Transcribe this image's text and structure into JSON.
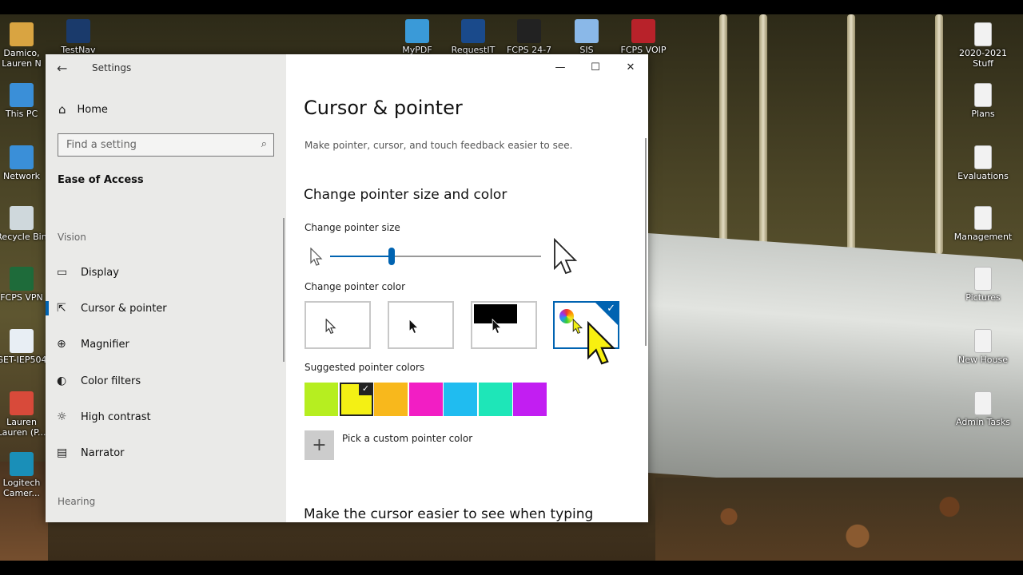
{
  "desktop": {
    "icons_left": [
      {
        "label": "Damico,\nLauren N",
        "icon": "user-folder-icon",
        "color": "#d9a441"
      },
      {
        "label": "This PC",
        "icon": "computer-icon",
        "color": "#3a8fd8"
      },
      {
        "label": "Network",
        "icon": "network-icon",
        "color": "#3a8fd8"
      },
      {
        "label": "Recycle Bin",
        "icon": "recycle-bin-icon",
        "color": "#cfd8dc"
      },
      {
        "label": "FCPS VPN",
        "icon": "vpn-icon",
        "color": "#1e6b3a"
      },
      {
        "label": "GET-IEP504",
        "icon": "app-icon",
        "color": "#e8eef4"
      },
      {
        "label": "Lauren\nLauren (P...",
        "icon": "chrome-icon",
        "color": "#d84a3a"
      },
      {
        "label": "Logitech\nCamer...",
        "icon": "camera-icon",
        "color": "#1a8fb8"
      }
    ],
    "icons_top": [
      {
        "label": "TestNav",
        "icon": "pearson-icon",
        "color": "#1a3a6b"
      },
      {
        "label": "MyPDF",
        "icon": "pdf-icon",
        "color": "#3a9ad8"
      },
      {
        "label": "RequestIT",
        "icon": "request-icon",
        "color": "#1a4a8b"
      },
      {
        "label": "FCPS 24-7",
        "icon": "blackboard-icon",
        "color": "#222222"
      },
      {
        "label": "SIS",
        "icon": "sis-icon",
        "color": "#8ab8e8"
      },
      {
        "label": "FCPS VOIP",
        "icon": "voip-icon",
        "color": "#b8222a"
      }
    ],
    "icons_right": [
      {
        "label": "2020-2021\nStuff",
        "icon": "document-icon"
      },
      {
        "label": "Plans",
        "icon": "document-icon"
      },
      {
        "label": "Evaluations",
        "icon": "document-icon"
      },
      {
        "label": "Management",
        "icon": "document-icon"
      },
      {
        "label": "Pictures",
        "icon": "document-icon"
      },
      {
        "label": "New House",
        "icon": "document-icon"
      },
      {
        "label": "Admin Tasks",
        "icon": "book-icon"
      }
    ]
  },
  "window": {
    "app_title": "Settings",
    "back_glyph": "←",
    "caption": {
      "minimize": "—",
      "maximize": "☐",
      "close": "✕"
    }
  },
  "nav": {
    "home": "Home",
    "search_placeholder": "Find a setting",
    "breadcrumb": "Ease of Access",
    "group_vision": "Vision",
    "group_hearing": "Hearing",
    "items": [
      {
        "label": "Display",
        "icon": "display-icon",
        "glyph": "▭",
        "active": false
      },
      {
        "label": "Cursor & pointer",
        "icon": "cursor-icon",
        "glyph": "⇱",
        "active": true
      },
      {
        "label": "Magnifier",
        "icon": "magnifier-icon",
        "glyph": "⊕",
        "active": false
      },
      {
        "label": "Color filters",
        "icon": "color-filters-icon",
        "glyph": "◐",
        "active": false
      },
      {
        "label": "High contrast",
        "icon": "high-contrast-icon",
        "glyph": "☼",
        "active": false
      },
      {
        "label": "Narrator",
        "icon": "narrator-icon",
        "glyph": "▤",
        "active": false
      }
    ]
  },
  "content": {
    "title": "Cursor & pointer",
    "description": "Make pointer, cursor, and touch feedback easier to see.",
    "section_size_color": "Change pointer size and color",
    "size_label": "Change pointer size",
    "size_value": 0.29,
    "color_label": "Change pointer color",
    "pointer_colors": [
      {
        "name": "white",
        "selected": false
      },
      {
        "name": "black",
        "selected": false
      },
      {
        "name": "inverted",
        "selected": false
      },
      {
        "name": "custom",
        "selected": true
      }
    ],
    "suggested_label": "Suggested pointer colors",
    "suggested_colors": [
      "#b6ee20",
      "#f4f014",
      "#f8b81c",
      "#f21ec4",
      "#20bcf0",
      "#1ee6b8",
      "#c21ef2"
    ],
    "suggested_selected": 1,
    "custom_label": "Pick a custom pointer color",
    "custom_glyph": "+",
    "section_typing": "Make the cursor easier to see when typing"
  }
}
